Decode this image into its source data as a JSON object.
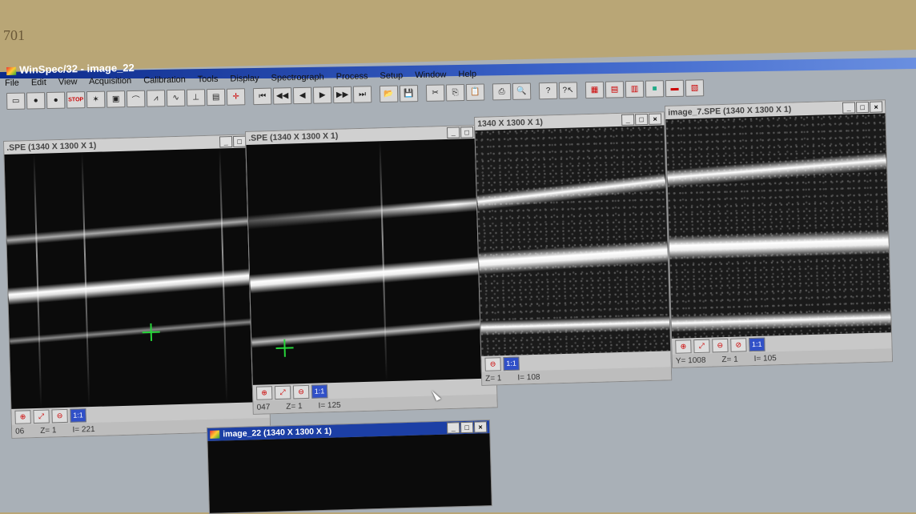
{
  "bezel": {
    "label": "701"
  },
  "app": {
    "title": "WinSpec/32 - image_22"
  },
  "menu": [
    "File",
    "Edit",
    "View",
    "Acquisition",
    "Calibration",
    "Tools",
    "Display",
    "Spectrograph",
    "Process",
    "Setup",
    "Window",
    "Help"
  ],
  "toolbar": {
    "stop_label": "STOP",
    "icons": [
      "new-image-icon",
      "circle-gray-icon",
      "circle-dark-icon",
      "stop-icon",
      "focus-icon",
      "window-icon",
      "graph-icon",
      "color-graph-icon",
      "wave-icon",
      "cursor-axes-icon",
      "info-icon",
      "crosshair-icon",
      "first-frame-icon",
      "prev-fast-icon",
      "prev-frame-icon",
      "next-frame-icon",
      "next-fast-icon",
      "last-frame-icon",
      "open-file-icon",
      "save-icon",
      "cut-icon",
      "copy-icon",
      "paste-icon",
      "print-icon",
      "print-preview-icon",
      "help-icon",
      "context-help-icon",
      "tile-icon",
      "cascade-icon",
      "grid-icon",
      "palette-icon",
      "hw-icon",
      "layout-icon"
    ]
  },
  "windows": [
    {
      "title": ".SPE (1340 X 1300 X 1)",
      "status": [
        "06",
        "Z=  1",
        "I=  221"
      ],
      "zoom": "1:1"
    },
    {
      "title": ".SPE (1340 X 1300 X 1)",
      "status": [
        "047",
        "Z=  1",
        "I=  125"
      ],
      "zoom": "1:1"
    },
    {
      "title": "1340 X 1300 X 1)",
      "status": [
        "Z=  1",
        "I=  108"
      ],
      "zoom": "1:1"
    },
    {
      "title": "image_7.SPE (1340 X 1300 X 1)",
      "status": [
        "Y= 1008",
        "Z=  1",
        "I=  105"
      ],
      "zoom": "1:1"
    },
    {
      "title": "image_22 (1340 X 1300 X 1)",
      "status": [],
      "zoom": ""
    }
  ],
  "win_buttons": {
    "min": "_",
    "max": "□",
    "close": "×"
  }
}
